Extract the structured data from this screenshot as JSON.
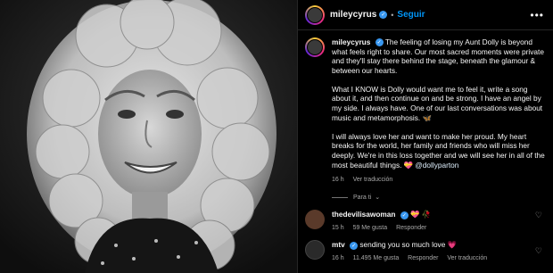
{
  "post": {
    "username": "mileycyrus",
    "follow_label": "Seguir",
    "more_label": "•••",
    "separator": "•"
  },
  "caption": {
    "username": "mileycyrus",
    "p1": "The feeling of losing my Aunt Dolly is beyond what feels right to share. Our most sacred moments were private and they'll stay there behind the stage, beneath the glamour & between our hearts.",
    "p2": "What I KNOW is Dolly would want me to feel it, write a song about it, and then continue on and be strong. I have an angel by my side. I always have. One of our last conversations was about music and metamorphosis. 🦋",
    "p3_text": "I will always love her and want to make her proud. My heart breaks for the world, her family and friends who will miss her deeply. We're in this loss together and we will see her in all of the most beautiful things. 💝",
    "p3_mention": "@dollyparton",
    "time": "16 h",
    "translate": "Ver traducción"
  },
  "thread_label": "Para ti",
  "comments": [
    {
      "username": "thedevilisawoman",
      "text": "💝 🥀",
      "time": "15 h",
      "likes": "59 Me gusta",
      "reply": "Responder",
      "avatar_color": "#5a3a2a"
    },
    {
      "username": "mtv",
      "text": "sending you so much love 💗",
      "time": "16 h",
      "likes": "11.495 Me gusta",
      "reply": "Responder",
      "translate": "Ver traducción",
      "avatar_color": "#2a2a2a"
    }
  ],
  "colors": {
    "link": "#0095f6",
    "verified": "#3897f0",
    "muted": "#a8a8a8"
  }
}
